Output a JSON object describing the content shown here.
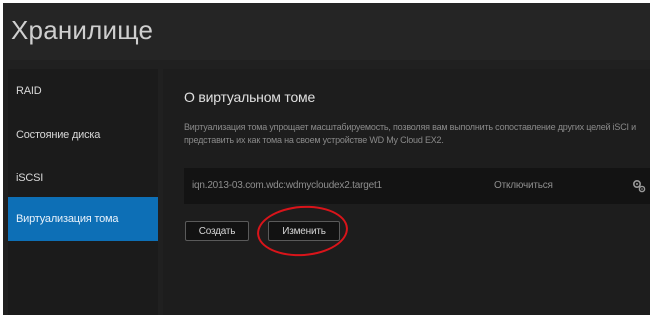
{
  "header": {
    "title": "Хранилище"
  },
  "sidebar": {
    "items": [
      {
        "label": "RAID",
        "active": false
      },
      {
        "label": "Состояние диска",
        "active": false
      },
      {
        "label": "iSCSI",
        "active": false
      },
      {
        "label": "Виртуализация тома",
        "active": true
      }
    ]
  },
  "main": {
    "title": "О виртуальном томе",
    "description": "Виртуализация тома упрощает масштабируемость, позволяя вам выполнить сопоставление других целей iSCI и представить их как тома на своем устройстве WD My Cloud EX2.",
    "volume": {
      "iqn": "iqn.2013-03.com.wdc:wdmycloudex2.target1",
      "action_label": "Отключиться",
      "icon": "settings-icon"
    },
    "buttons": {
      "create": "Создать",
      "edit": "Изменить"
    }
  },
  "colors": {
    "accent": "#0d6fb6",
    "highlight": "#d9141a",
    "background": "#202020"
  }
}
